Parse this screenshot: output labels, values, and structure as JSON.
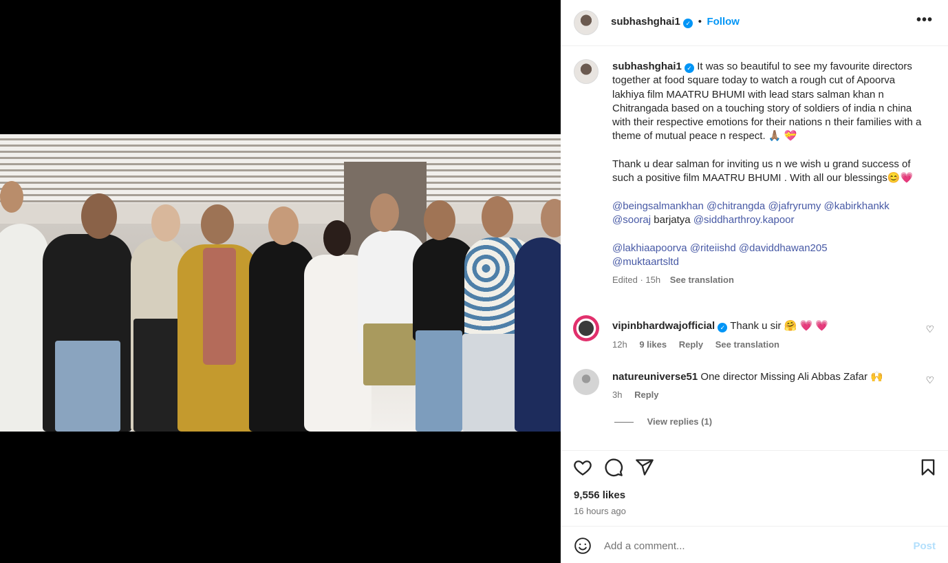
{
  "post": {
    "author": "subhashghai1",
    "follow_label": "Follow",
    "separator": "•",
    "more_label": "•••"
  },
  "caption": {
    "author": "subhashghai1",
    "para1": "It was so beautiful to see my favourite directors together at food square today to watch a rough cut of Apoorva lakhiya film MAATRU BHUMI with lead stars salman khan n Chitrangada based on a touching story of soldiers of india n china with their respective emotions for their nations n their families with a theme of mutual peace n respect. 🙏🏽 💝",
    "para2": "Thank u dear salman for inviting us n we wish u grand success of such a positive film MAATRU BHUMI . With all our blessings😊💗",
    "mentions1": [
      "@beingsalmankhan",
      "@chitrangda",
      "@jafryrumy",
      "@kabirkhankk",
      "@sooraj"
    ],
    "mentions1_tail": "barjatya",
    "mentions1_last": "@siddharthroy.kapoor",
    "mentions2": [
      "@lakhiaapoorva",
      "@riteiishd",
      "@daviddhawan205",
      "@muktaartsltd"
    ],
    "edited": "Edited · 15h",
    "see_translation": "See translation"
  },
  "comments": [
    {
      "user": "vipinbhardwajofficial",
      "text": "Thank u sir 🤗 💗 💗",
      "time": "12h",
      "likes": "9 likes",
      "reply": "Reply",
      "see_translation": "See translation"
    },
    {
      "user": "natureuniverse51",
      "text": "One director Missing Ali Abbas Zafar 🙌",
      "time": "3h",
      "reply": "Reply",
      "view_replies": "View replies (1)"
    }
  ],
  "stats": {
    "likes": "9,556 likes",
    "time_ago": "16 hours ago"
  },
  "add_comment": {
    "placeholder": "Add a comment...",
    "post_label": "Post"
  },
  "colors": {
    "accent": "#0095f6",
    "mention": "#4759a5",
    "secondary_text": "#737373",
    "border": "#efefef"
  },
  "icons": [
    "heart-icon",
    "comment-icon",
    "share-icon",
    "bookmark-icon",
    "emoji-icon",
    "verified-icon",
    "more-icon"
  ]
}
